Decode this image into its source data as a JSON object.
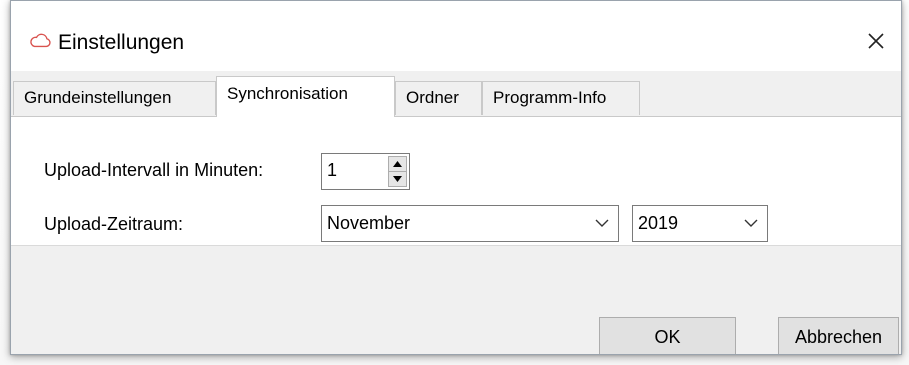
{
  "window": {
    "title": "Einstellungen",
    "app_icon": "cloud-icon",
    "close_icon": "close-icon",
    "close_glyph": "✕"
  },
  "tabs": [
    {
      "label": "Grundeinstellungen",
      "active": false
    },
    {
      "label": "Synchronisation",
      "active": true
    },
    {
      "label": "Ordner",
      "active": false
    },
    {
      "label": "Programm-Info",
      "active": false
    }
  ],
  "sync": {
    "interval_label": "Upload-Intervall in Minuten:",
    "interval_value": "1",
    "period_label": "Upload-Zeitraum:",
    "month_value": "November",
    "year_value": "2019"
  },
  "buttons": {
    "ok_label": "OK",
    "cancel_label": "Abbrechen"
  },
  "colors": {
    "icon_accent": "#d9534f",
    "panel_background": "#f0f0f0",
    "content_background": "#ffffff"
  }
}
